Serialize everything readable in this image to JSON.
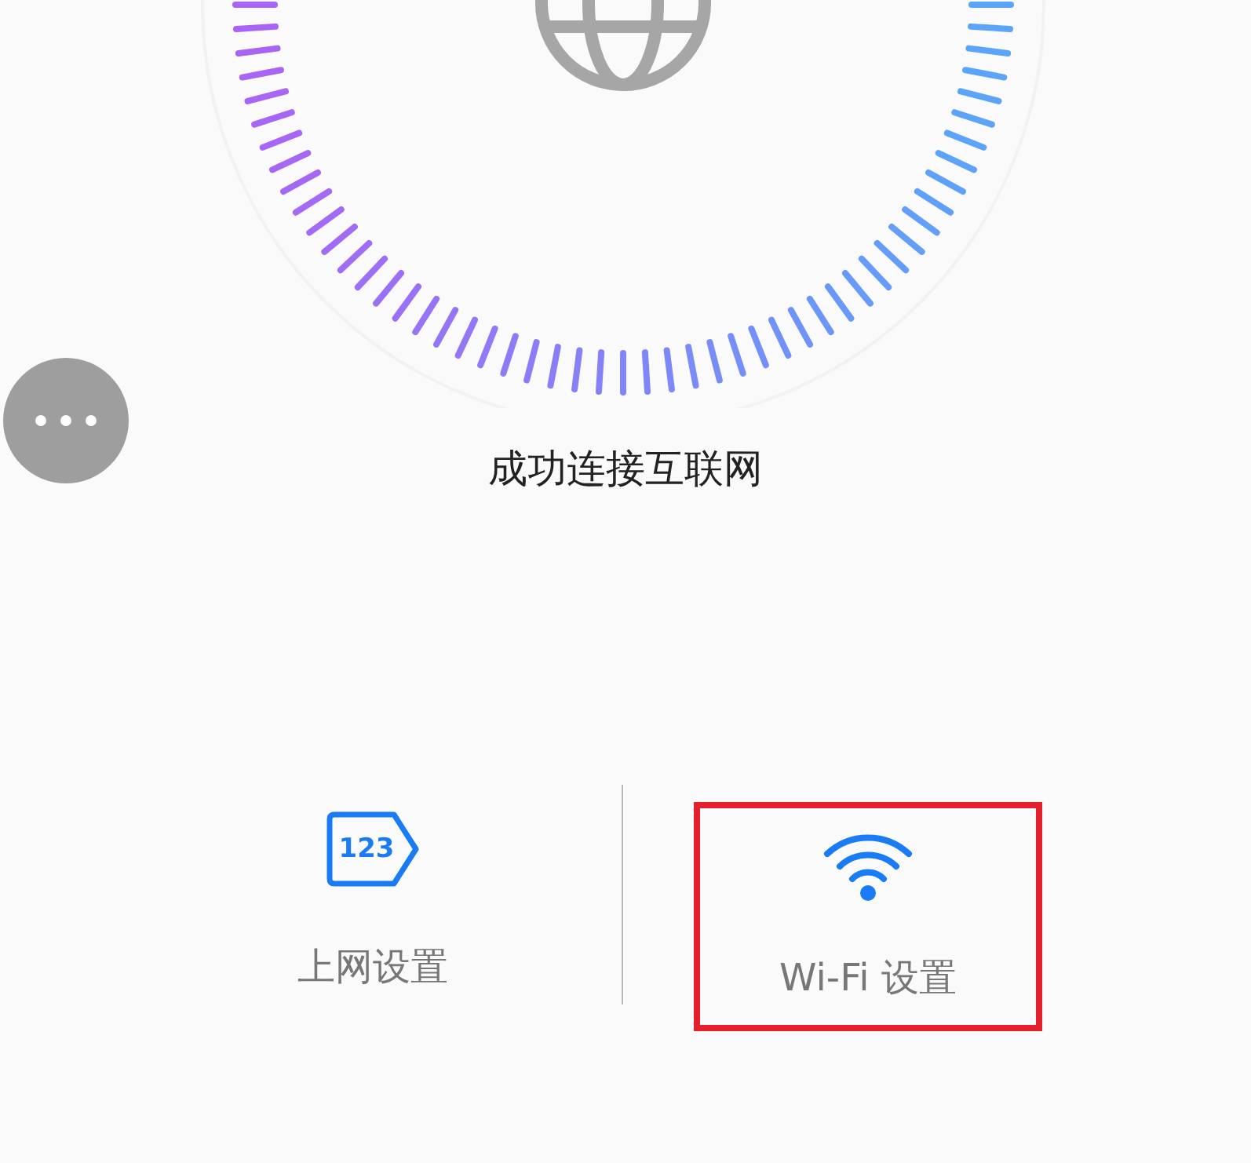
{
  "status": {
    "text": "成功连接互联网"
  },
  "settings": [
    {
      "kind": "number",
      "icon_text": "123",
      "label": "上网设置",
      "highlighted": false
    },
    {
      "kind": "wifi",
      "label": "Wi-Fi 设置",
      "highlighted": true
    }
  ]
}
